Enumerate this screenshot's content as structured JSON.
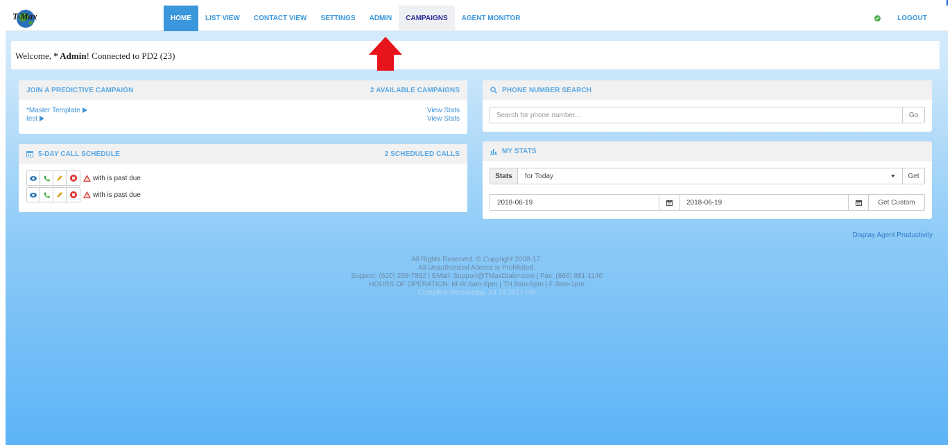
{
  "nav": {
    "items": [
      "HOME",
      "LIST VIEW",
      "CONTACT VIEW",
      "SETTINGS",
      "ADMIN",
      "CAMPAIGNS",
      "AGENT MONITOR"
    ],
    "logout": "LOGOUT",
    "logo_text": "T-Max"
  },
  "welcome": {
    "prefix": "Welcome, ",
    "user": "* Admin",
    "suffix": "! Connected to PD2 (23)"
  },
  "join": {
    "title": "JOIN A PREDICTIVE CAMPAIGN",
    "count": "2 AVAILABLE CAMPAIGNS",
    "campaigns": [
      {
        "name": "*Master Template",
        "stats": "View Stats"
      },
      {
        "name": "test",
        "stats": "View Stats"
      }
    ]
  },
  "schedule": {
    "title": "5-DAY CALL SCHEDULE",
    "count": "2 SCHEDULED CALLS",
    "rows": [
      {
        "text": "with is past due"
      },
      {
        "text": "with is past due"
      }
    ]
  },
  "phone": {
    "title": "PHONE NUMBER SEARCH",
    "placeholder": "Search for phone number...",
    "go": "Go"
  },
  "stats": {
    "title": "MY STATS",
    "label": "Stats",
    "selected": "for Today",
    "get": "Get",
    "date_from": "2018-06-19",
    "date_to": "2018-06-19",
    "get_custom": "Get Custom"
  },
  "productivity": "Display Agent Productivity",
  "footer": {
    "line1": "All Rights Reserved. © Copyright 2008-17.",
    "line2": "All Unauthorized Access is Prohibited.",
    "line3": "Support: (620) 259-7892 | EMail: Support@TMaxDialer.com | Fax: (866) 861-1146",
    "line4": "HOURS OF OPERATION: M-W 8am-6pm | TH 8am-5pm | F 8am-1pm",
    "line5": "Compiled Wednesday Jul 19 2017 PM"
  },
  "colors": {
    "accent": "#3a97dc",
    "arrow": "#e8141c",
    "ok": "#4cae4c",
    "danger": "#d9302c"
  }
}
